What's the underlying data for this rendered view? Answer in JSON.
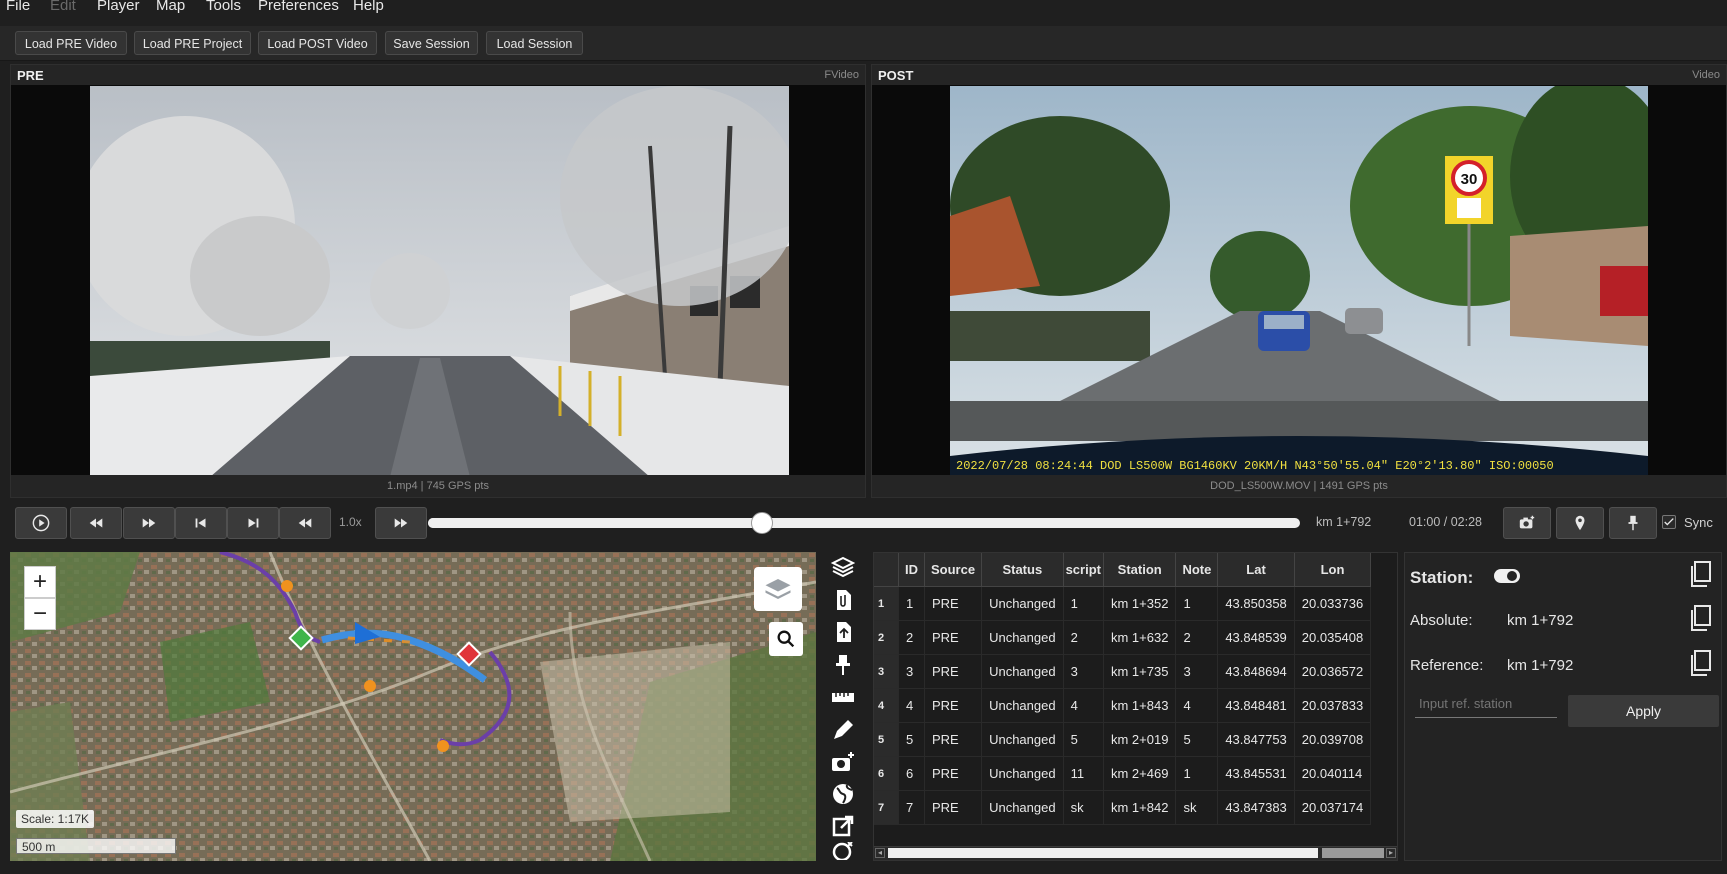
{
  "menu": [
    "File",
    "Edit",
    "Player",
    "Map",
    "Tools",
    "Preferences",
    "Help"
  ],
  "toolbar": {
    "load_pre_video": "Load PRE Video",
    "load_pre_project": "Load PRE Project",
    "load_post_video": "Load POST Video",
    "save_session": "Save Session",
    "load_session": "Load Session"
  },
  "pre": {
    "title": "PRE",
    "tag": "FVideo",
    "footer": "1.mp4  |  745 GPS pts"
  },
  "post": {
    "title": "POST",
    "tag": "Video",
    "footer": "DOD_LS500W.MOV  |  1491 GPS pts",
    "overlay": "2022/07/28 08:24:44 DOD LS500W   BG1460KV  20KM/H N43°50′55.04″ E20°2′13.80″ ISO:00050",
    "sign_speed": "30"
  },
  "transport": {
    "speed": "1.0x",
    "station": "km 1+792",
    "time": "01:00 / 02:28",
    "sync": "Sync",
    "progress": 0.38
  },
  "map": {
    "scale": "Scale: 1:17K",
    "scale_bar": "500 m"
  },
  "table": {
    "headers": [
      "ID",
      "Source",
      "Status",
      "script",
      "Station",
      "Note",
      "Lat",
      "Lon"
    ],
    "rows": [
      [
        "1",
        "1",
        "PRE",
        "Unchanged",
        "1",
        "km 1+352",
        "1",
        "43.850358",
        "20.033736"
      ],
      [
        "2",
        "2",
        "PRE",
        "Unchanged",
        "2",
        "km 1+632",
        "2",
        "43.848539",
        "20.035408"
      ],
      [
        "3",
        "3",
        "PRE",
        "Unchanged",
        "3",
        "km 1+735",
        "3",
        "43.848694",
        "20.036572"
      ],
      [
        "4",
        "4",
        "PRE",
        "Unchanged",
        "4",
        "km 1+843",
        "4",
        "43.848481",
        "20.037833"
      ],
      [
        "5",
        "5",
        "PRE",
        "Unchanged",
        "5",
        "km 2+019",
        "5",
        "43.847753",
        "20.039708"
      ],
      [
        "6",
        "6",
        "PRE",
        "Unchanged",
        "11",
        "km 2+469",
        "1",
        "43.845531",
        "20.040114"
      ],
      [
        "7",
        "7",
        "PRE",
        "Unchanged",
        "sk",
        "km 1+842",
        "sk",
        "43.847383",
        "20.037174"
      ]
    ]
  },
  "station_panel": {
    "station_label": "Station:",
    "absolute_label": "Absolute:",
    "absolute_value": "km 1+792",
    "reference_label": "Reference:",
    "reference_value": "km 1+792",
    "input_placeholder": "Input ref. station",
    "apply": "Apply"
  },
  "colors": {
    "accent_route": "#3f8fe0",
    "purple_route": "#6b3fa8",
    "start_marker": "#3fb54a",
    "end_marker": "#e0343a",
    "poi": "#f0921e"
  }
}
